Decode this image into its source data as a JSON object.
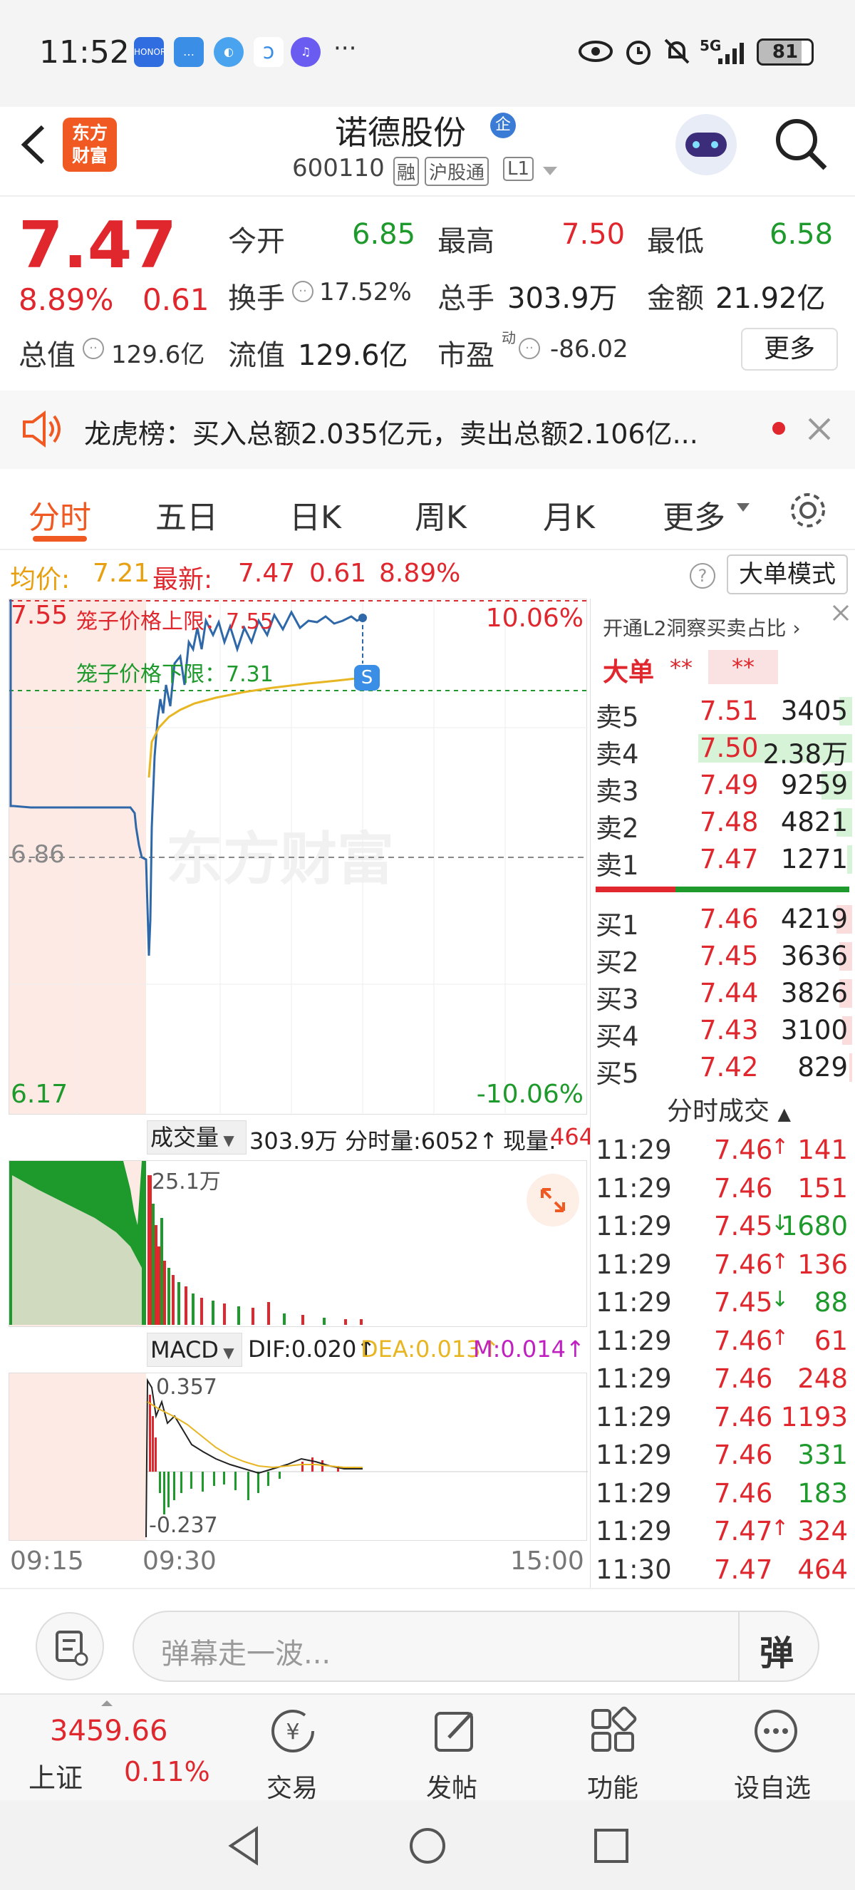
{
  "status_bar": {
    "time": "11:52",
    "battery": "81",
    "icons": [
      "honor-app-icon",
      "chat-icon",
      "browser-icon",
      "assistant-icon",
      "music-icon",
      "more-icon"
    ],
    "right_icons": [
      "eye-icon",
      "alarm-icon",
      "mute-icon",
      "5g-signal-icon",
      "battery-icon"
    ],
    "network": "5G"
  },
  "header": {
    "logo_text_line1": "东方",
    "logo_text_line2": "财富",
    "stock_name": "诺德股份",
    "tag_badge": "企",
    "stock_code": "600110",
    "tag_margin": "融",
    "tag_connect": "沪股通",
    "tag_level": "L1"
  },
  "quote": {
    "price": "7.47",
    "change_pct": "8.89%",
    "change_abs": "0.61",
    "open_label": "今开",
    "open_value": "6.85",
    "high_label": "最高",
    "high_value": "7.50",
    "low_label": "最低",
    "low_value": "6.58",
    "turnover_label": "换手",
    "turnover_value": "17.52%",
    "volume_label": "总手",
    "volume_value": "303.9万",
    "amount_label": "金额",
    "amount_value": "21.92亿",
    "mcap_label": "总值",
    "mcap_value": "129.6亿",
    "float_label": "流值",
    "float_value": "129.6亿",
    "pe_label": "市盈",
    "pe_sup": "动",
    "pe_value": "-86.02",
    "more_button": "更多"
  },
  "notice": {
    "text": "龙虎榜：买入总额2.035亿元，卖出总额2.106亿..."
  },
  "tabs": {
    "items": [
      "分时",
      "五日",
      "日K",
      "周K",
      "月K",
      "更多"
    ],
    "active": "分时"
  },
  "avg_bar": {
    "avg_label": "均价:",
    "avg_value": "7.21",
    "latest_label": "最新:",
    "latest_value": "7.47",
    "latest_change": "0.61",
    "latest_pct": "8.89%",
    "big_order_button": "大单模式"
  },
  "price_chart": {
    "ymax_label": "7.55",
    "ymid_label": "6.86",
    "ymin_label": "6.17",
    "pct_max_label": "10.06%",
    "pct_min_label": "-10.06%",
    "upper_limit_text": "笼子价格上限：7.55",
    "lower_limit_text": "笼子价格下限：7.31",
    "s_marker": "S",
    "watermark": "东方财富"
  },
  "volume_panel": {
    "selector": "成交量",
    "total": "303.9万",
    "period_label": "分时量:6052↑",
    "now_label": "现量:",
    "now_value": "464",
    "max_label": "25.1万"
  },
  "macd_panel": {
    "selector": "MACD",
    "dif": "DIF:0.020↑",
    "dea": "DEA:0.013↑",
    "m": "M:0.014↑",
    "max_label": "0.357",
    "min_label": "-0.237"
  },
  "time_axis": {
    "t1": "09:15",
    "t2": "09:30",
    "t3": "15:00"
  },
  "order_book": {
    "header": "开通L2洞察买卖占比",
    "big_order_label": "大单",
    "big_order_v1": "**",
    "big_order_v2": "**",
    "asks": [
      {
        "label": "卖5",
        "price": "7.51",
        "vol": "3405",
        "fill": 0.05
      },
      {
        "label": "卖4",
        "price": "7.50",
        "vol": "2.38万",
        "fill": 0.6
      },
      {
        "label": "卖3",
        "price": "7.49",
        "vol": "9259",
        "fill": 0.12
      },
      {
        "label": "卖2",
        "price": "7.48",
        "vol": "4821",
        "fill": 0.06
      },
      {
        "label": "卖1",
        "price": "7.47",
        "vol": "1271",
        "fill": 0.02
      }
    ],
    "bids": [
      {
        "label": "买1",
        "price": "7.46",
        "vol": "4219",
        "fill": 0.06
      },
      {
        "label": "买2",
        "price": "7.45",
        "vol": "3636",
        "fill": 0.05
      },
      {
        "label": "买3",
        "price": "7.44",
        "vol": "3826",
        "fill": 0.05
      },
      {
        "label": "买4",
        "price": "7.43",
        "vol": "3100",
        "fill": 0.04
      },
      {
        "label": "买5",
        "price": "7.42",
        "vol": "829",
        "fill": 0.01
      }
    ],
    "trades_header": "分时成交",
    "trades": [
      {
        "t": "11:29",
        "p": "7.46",
        "dir": "↑",
        "v": "141",
        "c": "red"
      },
      {
        "t": "11:29",
        "p": "7.46",
        "dir": "",
        "v": "151",
        "c": "red"
      },
      {
        "t": "11:29",
        "p": "7.45",
        "dir": "↓",
        "v": "1680",
        "c": "green"
      },
      {
        "t": "11:29",
        "p": "7.46",
        "dir": "↑",
        "v": "136",
        "c": "red"
      },
      {
        "t": "11:29",
        "p": "7.45",
        "dir": "↓",
        "v": "88",
        "c": "green"
      },
      {
        "t": "11:29",
        "p": "7.46",
        "dir": "↑",
        "v": "61",
        "c": "red"
      },
      {
        "t": "11:29",
        "p": "7.46",
        "dir": "",
        "v": "248",
        "c": "red"
      },
      {
        "t": "11:29",
        "p": "7.46",
        "dir": "",
        "v": "1193",
        "c": "red"
      },
      {
        "t": "11:29",
        "p": "7.46",
        "dir": "",
        "v": "331",
        "c": "green"
      },
      {
        "t": "11:29",
        "p": "7.46",
        "dir": "",
        "v": "183",
        "c": "green"
      },
      {
        "t": "11:29",
        "p": "7.47",
        "dir": "↑",
        "v": "324",
        "c": "red"
      },
      {
        "t": "11:30",
        "p": "7.47",
        "dir": "",
        "v": "464",
        "c": "red"
      }
    ]
  },
  "comment_bar": {
    "placeholder": "弹幕走一波..."
  },
  "bottom_nav": {
    "index_value": "3459.66",
    "index_name": "上证",
    "index_pct": "0.11%",
    "items": [
      "交易",
      "发帖",
      "功能",
      "设自选"
    ]
  },
  "colors": {
    "up": "#e0272e",
    "down": "#1e9a2c",
    "accent": "#f05a22",
    "avg_line": "#e8b623",
    "price_line": "#2f68a8"
  }
}
